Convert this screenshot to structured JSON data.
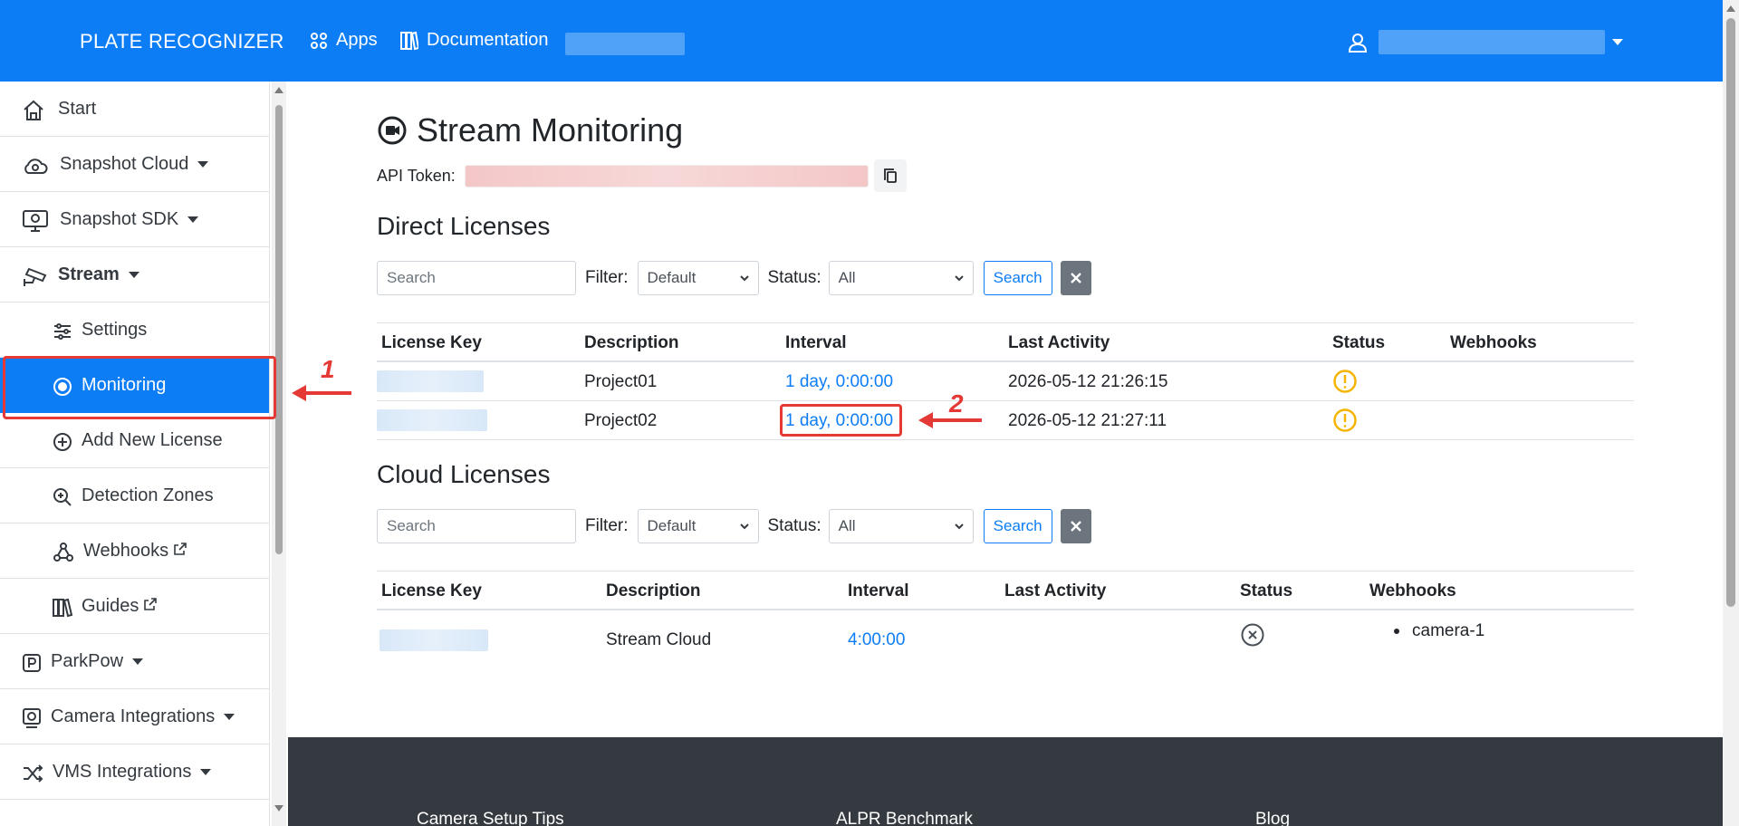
{
  "navbar": {
    "brand": "PLATE RECOGNIZER",
    "apps": "Apps",
    "documentation": "Documentation"
  },
  "sidebar": {
    "items": [
      {
        "label": "Start",
        "icon": "home-icon"
      },
      {
        "label": "Snapshot Cloud",
        "icon": "cloud-icon"
      },
      {
        "label": "Snapshot SDK",
        "icon": "monitor-icon"
      },
      {
        "label": "Stream",
        "icon": "cctv-camera-icon"
      },
      {
        "label": "Settings",
        "icon": "sliders-icon"
      },
      {
        "label": "Monitoring",
        "icon": "record-icon"
      },
      {
        "label": "Add New License",
        "icon": "plus-circle-icon"
      },
      {
        "label": "Detection Zones",
        "icon": "zoom-in-icon"
      },
      {
        "label": "Webhooks",
        "icon": "webhook-icon"
      },
      {
        "label": "Guides",
        "icon": "books-icon"
      },
      {
        "label": "ParkPow",
        "icon": "parking-icon"
      },
      {
        "label": "Camera Integrations",
        "icon": "camera-icon"
      },
      {
        "label": "VMS Integrations",
        "icon": "shuffle-icon"
      }
    ]
  },
  "page": {
    "title": "Stream Monitoring",
    "api_token_label": "API Token:"
  },
  "direct": {
    "title": "Direct Licenses",
    "search_placeholder": "Search",
    "filter_label": "Filter:",
    "filter_value": "Default",
    "status_label": "Status:",
    "status_value": "All",
    "search_button": "Search",
    "columns": [
      "License Key",
      "Description",
      "Interval",
      "Last Activity",
      "Status",
      "Webhooks"
    ],
    "rows": [
      {
        "description": "Project01",
        "interval": "1 day, 0:00:00",
        "last_activity": "2026-05-12 21:26:15",
        "status": "warning"
      },
      {
        "description": "Project02",
        "interval": "1 day, 0:00:00",
        "last_activity": "2026-05-12 21:27:11",
        "status": "warning"
      }
    ]
  },
  "cloud": {
    "title": "Cloud Licenses",
    "search_placeholder": "Search",
    "filter_label": "Filter:",
    "filter_value": "Default",
    "status_label": "Status:",
    "status_value": "All",
    "search_button": "Search",
    "columns": [
      "License Key",
      "Description",
      "Interval",
      "Last Activity",
      "Status",
      "Webhooks"
    ],
    "rows": [
      {
        "description": "Stream Cloud",
        "interval": "4:00:00",
        "last_activity": "",
        "status": "inactive",
        "webhooks": [
          "camera-1"
        ]
      }
    ]
  },
  "footer": {
    "links": [
      "Camera Setup Tips",
      "ALPR Benchmark",
      "Blog"
    ]
  },
  "annotations": {
    "one": "1",
    "two": "2"
  },
  "colors": {
    "brand": "#0d7df5",
    "warning": "#f5b400",
    "annotation": "#e53935"
  }
}
